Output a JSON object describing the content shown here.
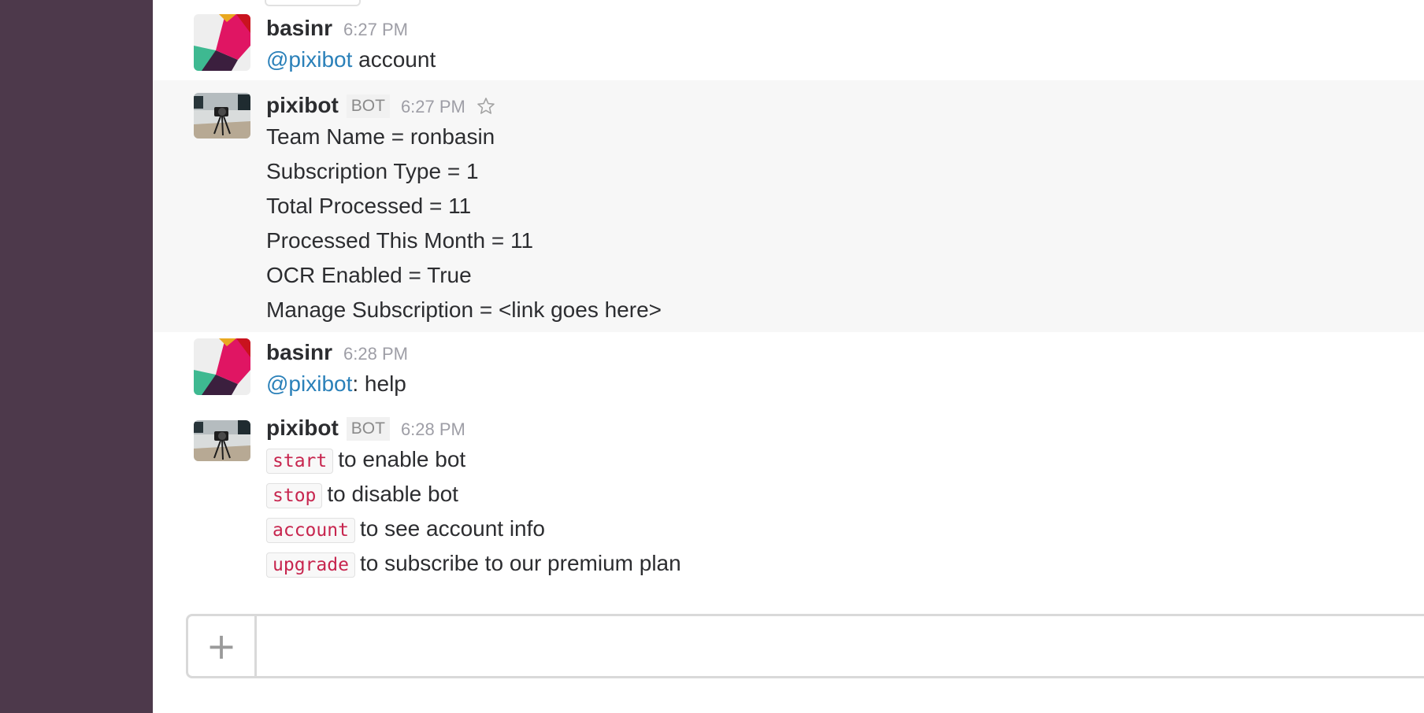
{
  "messages": [
    {
      "sender": "basinr",
      "time": "6:27 PM",
      "mention": "@pixibot",
      "text": " account"
    },
    {
      "sender": "pixibot",
      "badge": "BOT",
      "time": "6:27 PM",
      "lines": [
        "Team Name = ronbasin",
        "Subscription Type = 1",
        "Total Processed = 11",
        "Processed This Month = 11",
        "OCR Enabled  =  True",
        "Manage Subscription = <link goes here>"
      ]
    },
    {
      "sender": "basinr",
      "time": "6:28 PM",
      "mention": "@pixibot",
      "text": ": help"
    },
    {
      "sender": "pixibot",
      "badge": "BOT",
      "time": "6:28 PM",
      "commands": [
        {
          "code": "start",
          "text": "to enable bot"
        },
        {
          "code": "stop",
          "text": "to disable bot"
        },
        {
          "code": "account",
          "text": "to see account info"
        },
        {
          "code": "upgrade",
          "text": "to subscribe to our premium plan"
        }
      ]
    }
  ],
  "composer": {
    "plus_icon": "+",
    "placeholder": ""
  },
  "colors": {
    "sidebar": "#4d394b",
    "mention": "#2a80b9",
    "code": "#c7254e"
  },
  "icons": [
    "star-icon",
    "plus-icon",
    "slack-logo-avatar",
    "camera-photo-avatar"
  ]
}
